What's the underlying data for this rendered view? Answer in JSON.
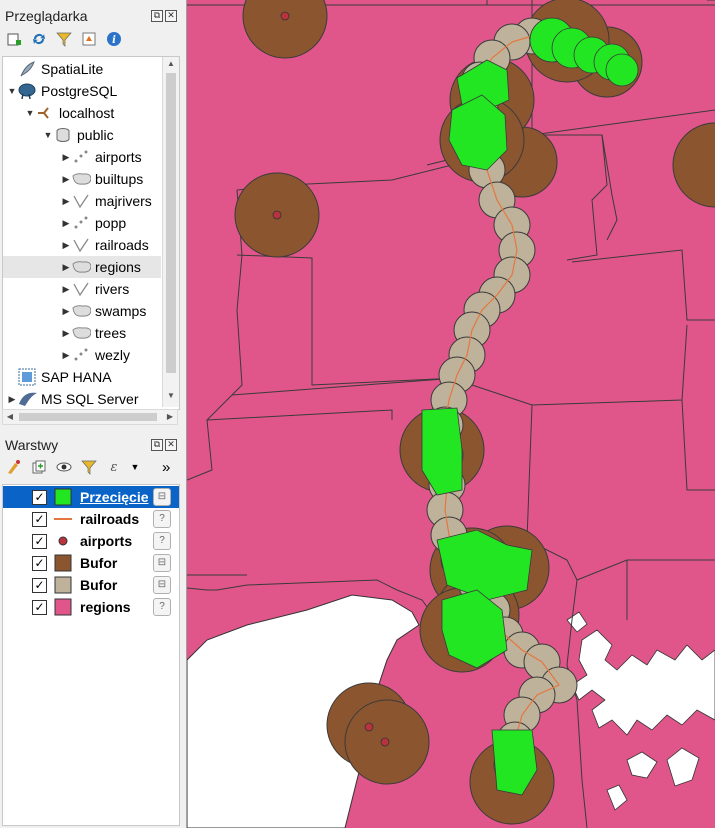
{
  "browser_panel": {
    "title": "Przeglądarka",
    "toolbar_icons": [
      "add-layer-icon",
      "refresh-icon",
      "filter-icon",
      "collapse-icon",
      "info-icon"
    ],
    "tree": [
      {
        "label": "SpatiaLite",
        "icon": "feather-icon",
        "level": 0,
        "expand": ""
      },
      {
        "label": "PostgreSQL",
        "icon": "elephant-icon",
        "level": 0,
        "expand": "open"
      },
      {
        "label": "localhost",
        "icon": "connection-icon",
        "level": 1,
        "expand": "open"
      },
      {
        "label": "public",
        "icon": "database-icon",
        "level": 2,
        "expand": "open"
      },
      {
        "label": "airports",
        "icon": "point-layer-icon",
        "level": 3,
        "expand": "closed"
      },
      {
        "label": "builtups",
        "icon": "polygon-layer-icon",
        "level": 3,
        "expand": "closed"
      },
      {
        "label": "majrivers",
        "icon": "line-layer-icon",
        "level": 3,
        "expand": "closed"
      },
      {
        "label": "popp",
        "icon": "point-layer-icon",
        "level": 3,
        "expand": "closed"
      },
      {
        "label": "railroads",
        "icon": "line-layer-icon",
        "level": 3,
        "expand": "closed"
      },
      {
        "label": "regions",
        "icon": "polygon-layer-icon",
        "level": 3,
        "expand": "closed"
      },
      {
        "label": "rivers",
        "icon": "line-layer-icon",
        "level": 3,
        "expand": "closed"
      },
      {
        "label": "swamps",
        "icon": "polygon-layer-icon",
        "level": 3,
        "expand": "closed"
      },
      {
        "label": "trees",
        "icon": "polygon-layer-icon",
        "level": 3,
        "expand": "closed"
      },
      {
        "label": "wezly",
        "icon": "point-layer-icon",
        "level": 3,
        "expand": "closed"
      },
      {
        "label": "SAP HANA",
        "icon": "hana-icon",
        "level": 0,
        "expand": ""
      },
      {
        "label": "MS SQL Server",
        "icon": "mssql-icon",
        "level": 0,
        "expand": "closed"
      }
    ],
    "selected_item": "regions"
  },
  "layers_panel": {
    "title": "Warstwy",
    "more_label": "»",
    "toolbar_icons": [
      "style-icon",
      "add-group-icon",
      "visibility-icon",
      "filter-legend-icon",
      "expression-filter-icon",
      "dropdown-icon"
    ],
    "layers": [
      {
        "name": "Przecięcie",
        "symbol": "fill",
        "color": "#22e622",
        "checked": true,
        "selected": true,
        "indicator": "embedded-icon"
      },
      {
        "name": "railroads",
        "symbol": "line",
        "color": "#e4773f",
        "checked": true,
        "selected": false,
        "indicator": "unknown-crs-icon"
      },
      {
        "name": "airports",
        "symbol": "point",
        "color": "#b8333d",
        "checked": true,
        "selected": false,
        "indicator": "unknown-crs-icon"
      },
      {
        "name": "Bufor",
        "symbol": "fill",
        "color": "#8b5530",
        "checked": true,
        "selected": false,
        "indicator": "embedded-icon"
      },
      {
        "name": "Bufor",
        "symbol": "fill",
        "color": "#bfb29a",
        "checked": true,
        "selected": false,
        "indicator": "embedded-icon"
      },
      {
        "name": "regions",
        "symbol": "fill",
        "color": "#e0568a",
        "checked": true,
        "selected": false,
        "indicator": "unknown-crs-icon"
      }
    ]
  },
  "map_colors": {
    "regions": "#e0568a",
    "water": "#ffffff",
    "outline": "#3a3a3a",
    "airport_buffer": "#8b5530",
    "rail_buffer": "#bfb29a",
    "intersection": "#22e622",
    "railroad": "#e4773f",
    "airport_point": "#b8333d"
  }
}
